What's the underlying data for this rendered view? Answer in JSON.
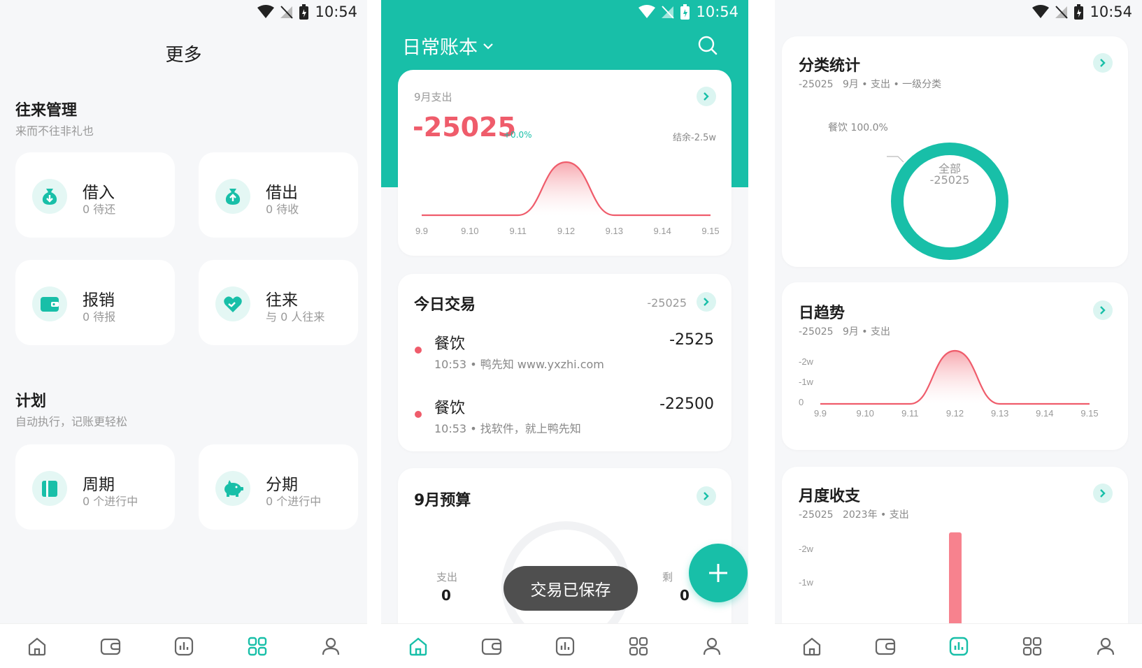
{
  "status": {
    "time": "10:54"
  },
  "p1": {
    "title": "更多",
    "sec1": {
      "title": "往来管理",
      "subtitle": "来而不往非礼也"
    },
    "tiles1": [
      {
        "label": "借入",
        "sub": "0 待还"
      },
      {
        "label": "借出",
        "sub": "0 待收"
      },
      {
        "label": "报销",
        "sub": "0 待报"
      },
      {
        "label": "往来",
        "sub": "与 0 人往来"
      }
    ],
    "sec2": {
      "title": "计划",
      "subtitle": "自动执行，记账更轻松"
    },
    "tiles2": [
      {
        "label": "周期",
        "sub": "0 个进行中"
      },
      {
        "label": "分期",
        "sub": "0 个进行中"
      }
    ]
  },
  "p2": {
    "ledger": "日常账本",
    "summary": {
      "label": "9月支出",
      "amount": "-25025",
      "pct": "+0.0%",
      "balance": "结余-2.5w"
    },
    "chart_data": {
      "type": "area",
      "categories": [
        "9.9",
        "9.10",
        "9.11",
        "9.12",
        "9.13",
        "9.14",
        "9.15"
      ],
      "values": [
        0,
        0,
        0,
        25025,
        0,
        0,
        0
      ]
    },
    "today": {
      "title": "今日交易",
      "total": "-25025",
      "items": [
        {
          "name": "餐饮",
          "sub": "10:53 • 鸭先知 www.yxzhi.com",
          "amount": "-2525"
        },
        {
          "name": "餐饮",
          "sub": "10:53 • 找软件，就上鸭先知",
          "amount": "-22500"
        }
      ]
    },
    "budget": {
      "title": "9月预算",
      "spent_label": "支出",
      "spent": "0",
      "remain_label": "剩",
      "remain": "0"
    },
    "toast": "交易已保存"
  },
  "p3": {
    "category": {
      "title": "分类统计",
      "sub": "-25025   9月 • 支出 • 一级分类",
      "slice_label": "餐饮 100.0%",
      "center_label": "全部",
      "center_value": "-25025",
      "chart_data": {
        "type": "pie",
        "categories": [
          "餐饮"
        ],
        "values": [
          100.0
        ]
      }
    },
    "daily": {
      "title": "日趋势",
      "sub": "-25025   9月 • 支出",
      "yticks": [
        "-2w",
        "-1w",
        "0"
      ],
      "chart_data": {
        "type": "area",
        "categories": [
          "9.9",
          "9.10",
          "9.11",
          "9.12",
          "9.13",
          "9.14",
          "9.15"
        ],
        "values": [
          0,
          0,
          0,
          25025,
          0,
          0,
          0
        ]
      }
    },
    "monthly": {
      "title": "月度收支",
      "sub": "-25025   2023年 • 支出",
      "yticks": [
        "-2w",
        "-1w"
      ],
      "chart_data": {
        "type": "bar",
        "values": [
          25025
        ]
      }
    }
  },
  "colors": {
    "accent": "#18bfa8",
    "expense": "#ef5c6b"
  }
}
